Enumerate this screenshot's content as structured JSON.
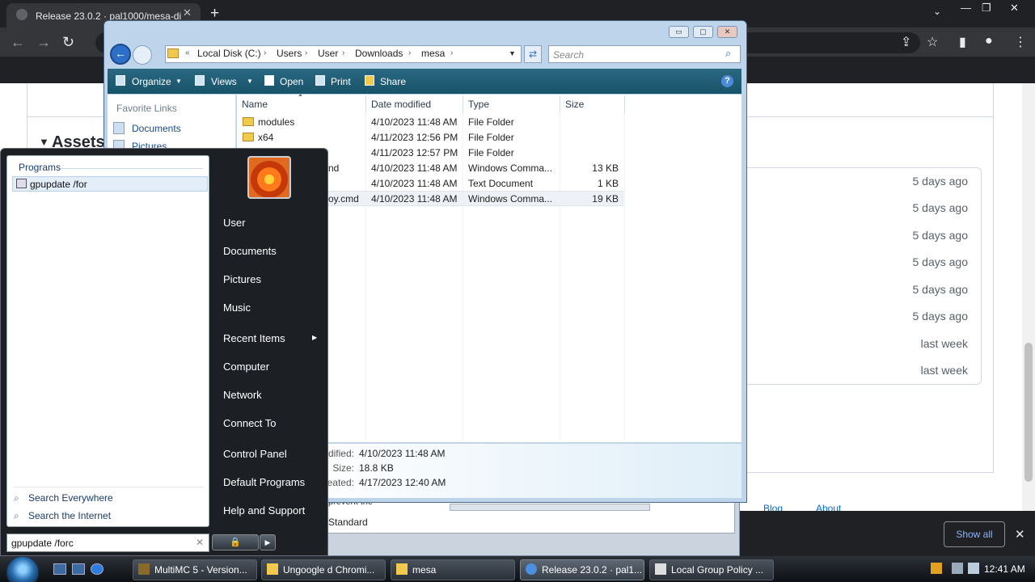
{
  "chrome": {
    "tab_title": "Release 23.0.2 · pal1000/mesa-di",
    "tab_close": "✕",
    "new_tab": "+",
    "tab_list": "⌄",
    "win_min": "—",
    "win_restore": "❐",
    "win_close": "✕",
    "back": "←",
    "forward": "→",
    "reload": "↻",
    "share_icon": "⇪",
    "star_icon": "☆",
    "sidepanel_icon": "▮",
    "profile_icon": "●",
    "menu_icon": "⋮"
  },
  "github": {
    "assets_heading": "Assets",
    "asset_dates": [
      "5 days ago",
      "5 days ago",
      "5 days ago",
      "5 days ago",
      "5 days ago",
      "5 days ago",
      "last week",
      "last week"
    ],
    "footer_blog": "Blog",
    "footer_about": "About",
    "show_all": "Show all",
    "close": "✕"
  },
  "group_policy": {
    "fragment": "prevent the",
    "tab_label": "Standard"
  },
  "explorer": {
    "caption": {
      "min": "▭",
      "max": "▢",
      "close": "✕"
    },
    "breadcrumb": [
      "Local Disk (C:)",
      "Users",
      "User",
      "Downloads",
      "mesa"
    ],
    "breadcrumb_lead": "«",
    "search_placeholder": "Search",
    "toolbar": {
      "organize": "Organize",
      "views": "Views",
      "open": "Open",
      "print": "Print",
      "share": "Share",
      "help": "?"
    },
    "nav": {
      "favorite_links": "Favorite Links",
      "items": [
        "Documents",
        "Pictures"
      ]
    },
    "columns": [
      "Name",
      "Date modified",
      "Type",
      "Size"
    ],
    "rows": [
      {
        "name": "modules",
        "date": "4/10/2023 11:48 AM",
        "type": "File Folder",
        "size": ""
      },
      {
        "name": "x64",
        "date": "4/11/2023 12:56 PM",
        "type": "File Folder",
        "size": ""
      },
      {
        "name": "",
        "date": "4/11/2023 12:57 PM",
        "type": "File Folder",
        "size": ""
      },
      {
        "name": "nd",
        "date": "4/10/2023 11:48 AM",
        "type": "Windows Comma...",
        "size": "13 KB"
      },
      {
        "name": "",
        "date": "4/10/2023 11:48 AM",
        "type": "Text Document",
        "size": "1 KB"
      },
      {
        "name": "oy.cmd",
        "date": "4/10/2023 11:48 AM",
        "type": "Windows Comma...",
        "size": "19 KB"
      }
    ],
    "details": {
      "modified_label": "dified:",
      "modified_value": "4/10/2023 11:48 AM",
      "size_label": "Size:",
      "size_value": "18.8 KB",
      "created_label": "eated:",
      "created_value": "4/17/2023 12:40 AM"
    }
  },
  "start_menu": {
    "programs_header": "Programs",
    "result": "gpupdate /for",
    "search_everywhere": "Search Everywhere",
    "search_internet": "Search the Internet",
    "search_value": "gpupdate /forc",
    "clear": "✕",
    "right_items": [
      "User",
      "Documents",
      "Pictures",
      "Music",
      "Recent Items",
      "Computer",
      "Network",
      "Connect To",
      "Control Panel",
      "Default Programs",
      "Help and Support"
    ],
    "lock": "🔒",
    "power": "▶"
  },
  "taskbar": {
    "tasks": [
      "MultiMC 5 - Version...",
      "Ungoogle d Chromi...",
      "mesa",
      "Release 23.0.2 · pal1...",
      "Local Group Policy ..."
    ],
    "time": "12:41 AM"
  }
}
